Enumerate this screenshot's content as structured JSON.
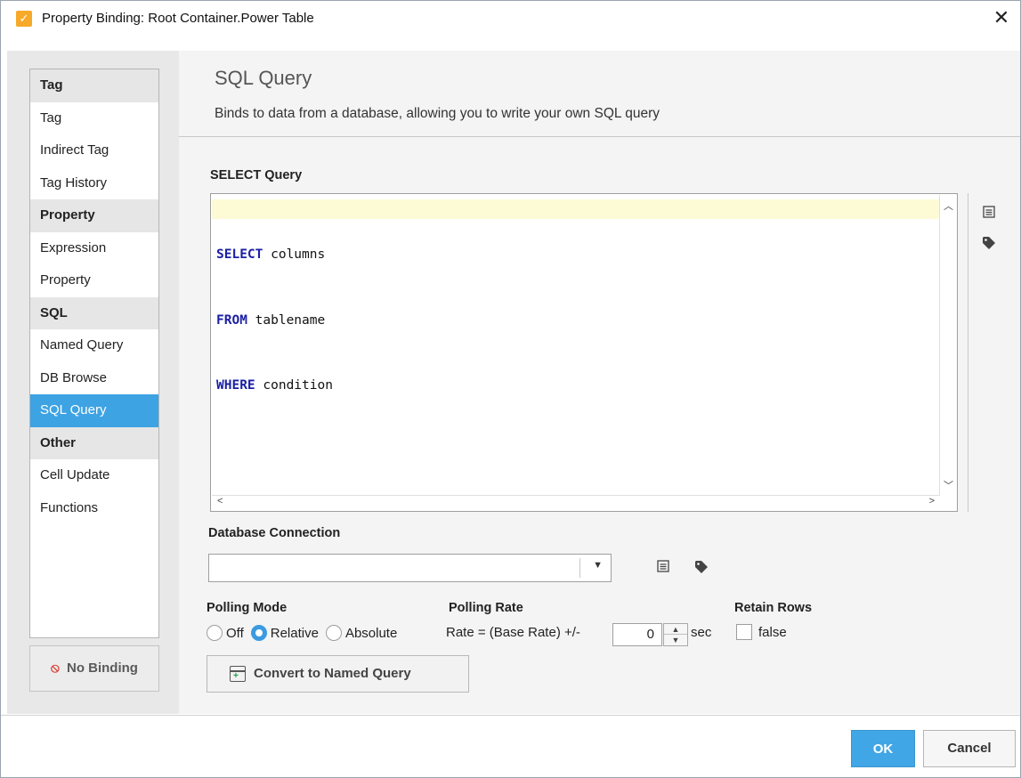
{
  "window": {
    "title": "Property Binding: Root Container.Power Table",
    "close_glyph": "✕"
  },
  "sidebar": {
    "groups": [
      {
        "header": "Tag",
        "items": [
          "Tag",
          "Indirect Tag",
          "Tag History"
        ]
      },
      {
        "header": "Property",
        "items": [
          "Expression",
          "Property"
        ]
      },
      {
        "header": "SQL",
        "items": [
          "Named Query",
          "DB Browse",
          "SQL Query"
        ]
      },
      {
        "header": "Other",
        "items": [
          "Cell Update",
          "Functions"
        ]
      }
    ],
    "selected": "SQL Query",
    "no_binding_label": "No Binding"
  },
  "header": {
    "title": "SQL Query",
    "description": "Binds to data from a database, allowing you to write your own SQL query"
  },
  "query": {
    "label": "SELECT Query",
    "lines": [
      {
        "keyword": "SELECT",
        "rest": " columns"
      },
      {
        "keyword": "FROM",
        "rest": " tablename"
      },
      {
        "keyword": "WHERE",
        "rest": " condition"
      }
    ]
  },
  "database": {
    "label": "Database Connection",
    "value": ""
  },
  "polling": {
    "mode_label": "Polling Mode",
    "options": [
      "Off",
      "Relative",
      "Absolute"
    ],
    "selected": "Relative",
    "rate_label": "Polling Rate",
    "rate_text": "Rate = (Base Rate) +/-",
    "rate_value": "0",
    "rate_unit": "sec"
  },
  "retain": {
    "label": "Retain Rows",
    "value_text": "false",
    "checked": false
  },
  "convert_label": "Convert to Named Query",
  "footer": {
    "ok_label": "OK",
    "cancel_label": "Cancel"
  },
  "colors": {
    "accent": "#3ea3e3",
    "keyword": "#1a1fa4",
    "highlight": "#fdfbd6",
    "no_binding_icon": "#d9423a"
  }
}
